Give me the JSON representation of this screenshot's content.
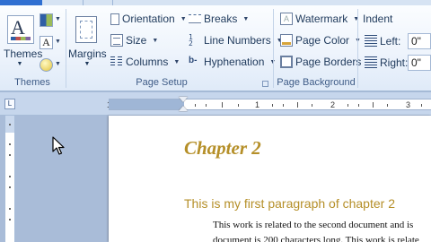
{
  "ribbon": {
    "themes": {
      "button_label": "Themes",
      "group_label": "Themes",
      "fonts_glyph": "A"
    },
    "page_setup": {
      "margins_label": "Margins",
      "orientation_label": "Orientation",
      "size_label": "Size",
      "columns_label": "Columns",
      "breaks_label": "Breaks",
      "line_numbers_label": "Line Numbers",
      "hyphenation_label": "Hyphenation",
      "group_label": "Page Setup"
    },
    "page_background": {
      "watermark_label": "Watermark",
      "page_color_label": "Page Color",
      "page_borders_label": "Page Borders",
      "group_label": "Page Background"
    },
    "paragraph": {
      "indent_label": "Indent",
      "left_label": "Left:",
      "left_value": "0\"",
      "right_label": "Right:",
      "right_value": "0\""
    }
  },
  "ruler": {
    "numbers": [
      "1",
      "1",
      "2",
      "3"
    ]
  },
  "document": {
    "chapter_title": "Chapter 2",
    "paragraph_heading": "This is my first paragraph of chapter 2",
    "body_line_1": "This work is related to the second document and is",
    "body_line_2": "document is 200 characters long. This work is relate"
  },
  "colors": {
    "accent": "#b58f28",
    "ribbon_text": "#1e395b",
    "group_label": "#3f5c87"
  }
}
